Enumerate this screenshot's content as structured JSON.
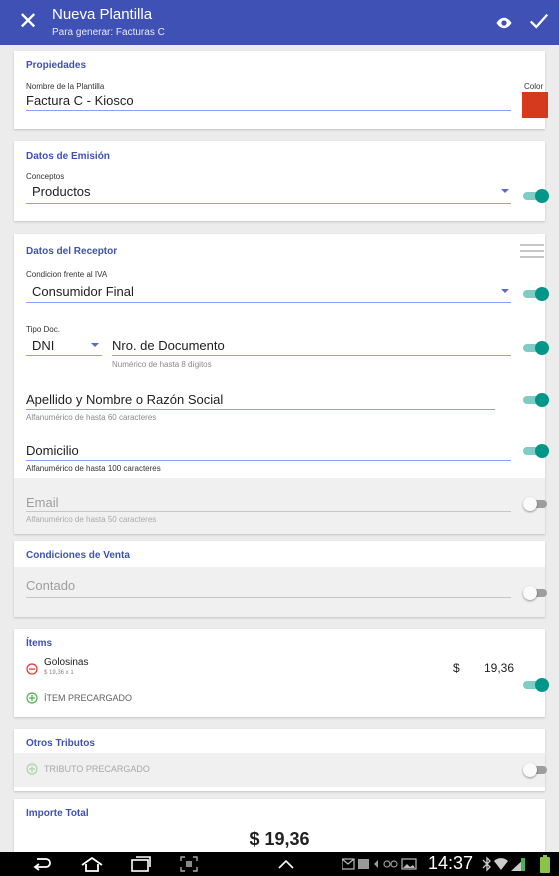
{
  "appbar": {
    "title": "Nueva Plantilla",
    "subtitle": "Para generar: Facturas C",
    "bg_color": "#3f51b5"
  },
  "propiedades": {
    "section_title": "Propiedades",
    "name_label": "Nombre de la Plantilla",
    "name_value": "Factura C - Kiosco",
    "color_label": "Color",
    "color_value": "#d63a1e"
  },
  "emision": {
    "section_title": "Datos de Emisión",
    "conceptos_label": "Conceptos",
    "conceptos_value": "Productos"
  },
  "receptor": {
    "section_title": "Datos del Receptor",
    "iva_label": "Condicion frente al IVA",
    "iva_value": "Consumidor Final",
    "tipo_doc_label": "Tipo Doc.",
    "tipo_doc_value": "DNI",
    "nro_doc_value": "Nro. de Documento",
    "nro_doc_hint": "Numérico de hasta 8 dígitos",
    "nombre_value": "Apellido y Nombre o Razón Social",
    "nombre_hint": "Alfanumérico de hasta 60 caracteres",
    "domicilio_value": "Domicilio",
    "domicilio_hint": "Alfanumérico de hasta 100 caracteres",
    "email_value": "Email",
    "email_hint": "Alfanumérico de hasta 50 caracteres"
  },
  "venta": {
    "section_title": "Condiciones de Venta",
    "value": "Contado"
  },
  "items": {
    "section_title": "Ítems",
    "list": [
      {
        "name": "Golosinas",
        "detail": "$ 19,36 x 1",
        "currency": "$",
        "amount": "19,36"
      }
    ],
    "add_label": "ÍTEM PRECARGADO"
  },
  "tributos": {
    "section_title": "Otros Tributos",
    "add_label": "TRIBUTO PRECARGADO"
  },
  "total": {
    "section_title": "Importe Total",
    "value": "$ 19,36"
  },
  "statusbar": {
    "time": "14:37"
  },
  "colors": {
    "accent": "#3f51b5",
    "toggle_on": "#009688",
    "remove": "#e53935",
    "add": "#4caf50"
  }
}
